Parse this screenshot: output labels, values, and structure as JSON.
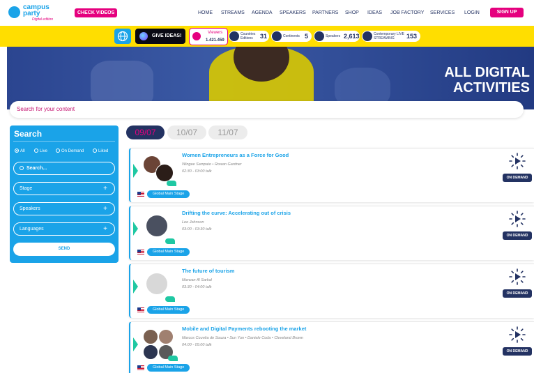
{
  "brand": {
    "line1": "campus",
    "line2": "party",
    "edition": "Digital edition"
  },
  "nav": {
    "check_videos": "CHECK VIDEOS",
    "items": [
      "HOME",
      "STREAMS",
      "AGENDA",
      "SPEAKERS",
      "PARTNERS",
      "SHOP",
      "IDEAS",
      "JOB FACTORY",
      "SERVICES"
    ],
    "login": "LOGIN",
    "signup": "SIGN UP"
  },
  "stats": {
    "give_ideas": "GIVE IDEAS!",
    "viewers_label": "Viewers",
    "viewers_value": "1.421.459",
    "countries_label": "Countries Editions",
    "countries_value": "31",
    "continents_label": "Continents",
    "continents_value": "5",
    "speakers_label": "Speakers",
    "speakers_value": "2,613",
    "streaming_label": "Contemporary LIVE STREAMING",
    "streaming_value": "153"
  },
  "hero": {
    "line1": "ALL DIGITAL",
    "line2": "ACTIVITIES"
  },
  "search": {
    "placeholder": "Search for your content"
  },
  "sidebar": {
    "title": "Search",
    "radios": [
      "All",
      "Live",
      "On Demand",
      "Liked"
    ],
    "search_placeholder": "Search...",
    "filters": [
      "Stage",
      "Speakers",
      "Languages"
    ],
    "send": "SEND"
  },
  "dates": [
    "09/07",
    "10/07",
    "11/07"
  ],
  "sessions": [
    {
      "title": "Women Entrepreneurs as a Force for Good",
      "speakers": "Wingee Sampaio • Rowan Gardner",
      "time": "02:30 - 03:00 talk",
      "stage": "Global Main Stage",
      "status": "ON DEMAND"
    },
    {
      "title": "Drifting the curve: Accelerating out of crisis",
      "speakers": "Leo Johnson",
      "time": "03:00 - 03:30 talk",
      "stage": "Global Main Stage",
      "status": "ON DEMAND"
    },
    {
      "title": "The future of tourism",
      "speakers": "Marwan Al Sarkal",
      "time": "03:30 - 04:00 talk",
      "stage": "Global Main Stage",
      "status": "ON DEMAND"
    },
    {
      "title": "Mobile and Digital Payments rebooting the market",
      "speakers": "Marcos Couvêa de Souza • Sun Yun • Daniele Coda • Cleveland Brown",
      "time": "04:00 - 05:00 talk",
      "stage": "Global Main Stage",
      "status": "ON DEMAND"
    }
  ],
  "colors": {
    "accent": "#e5007e",
    "blue": "#1aa3e8",
    "navy": "#233262",
    "yellow": "#ffde00",
    "teal": "#1fc8a3"
  }
}
